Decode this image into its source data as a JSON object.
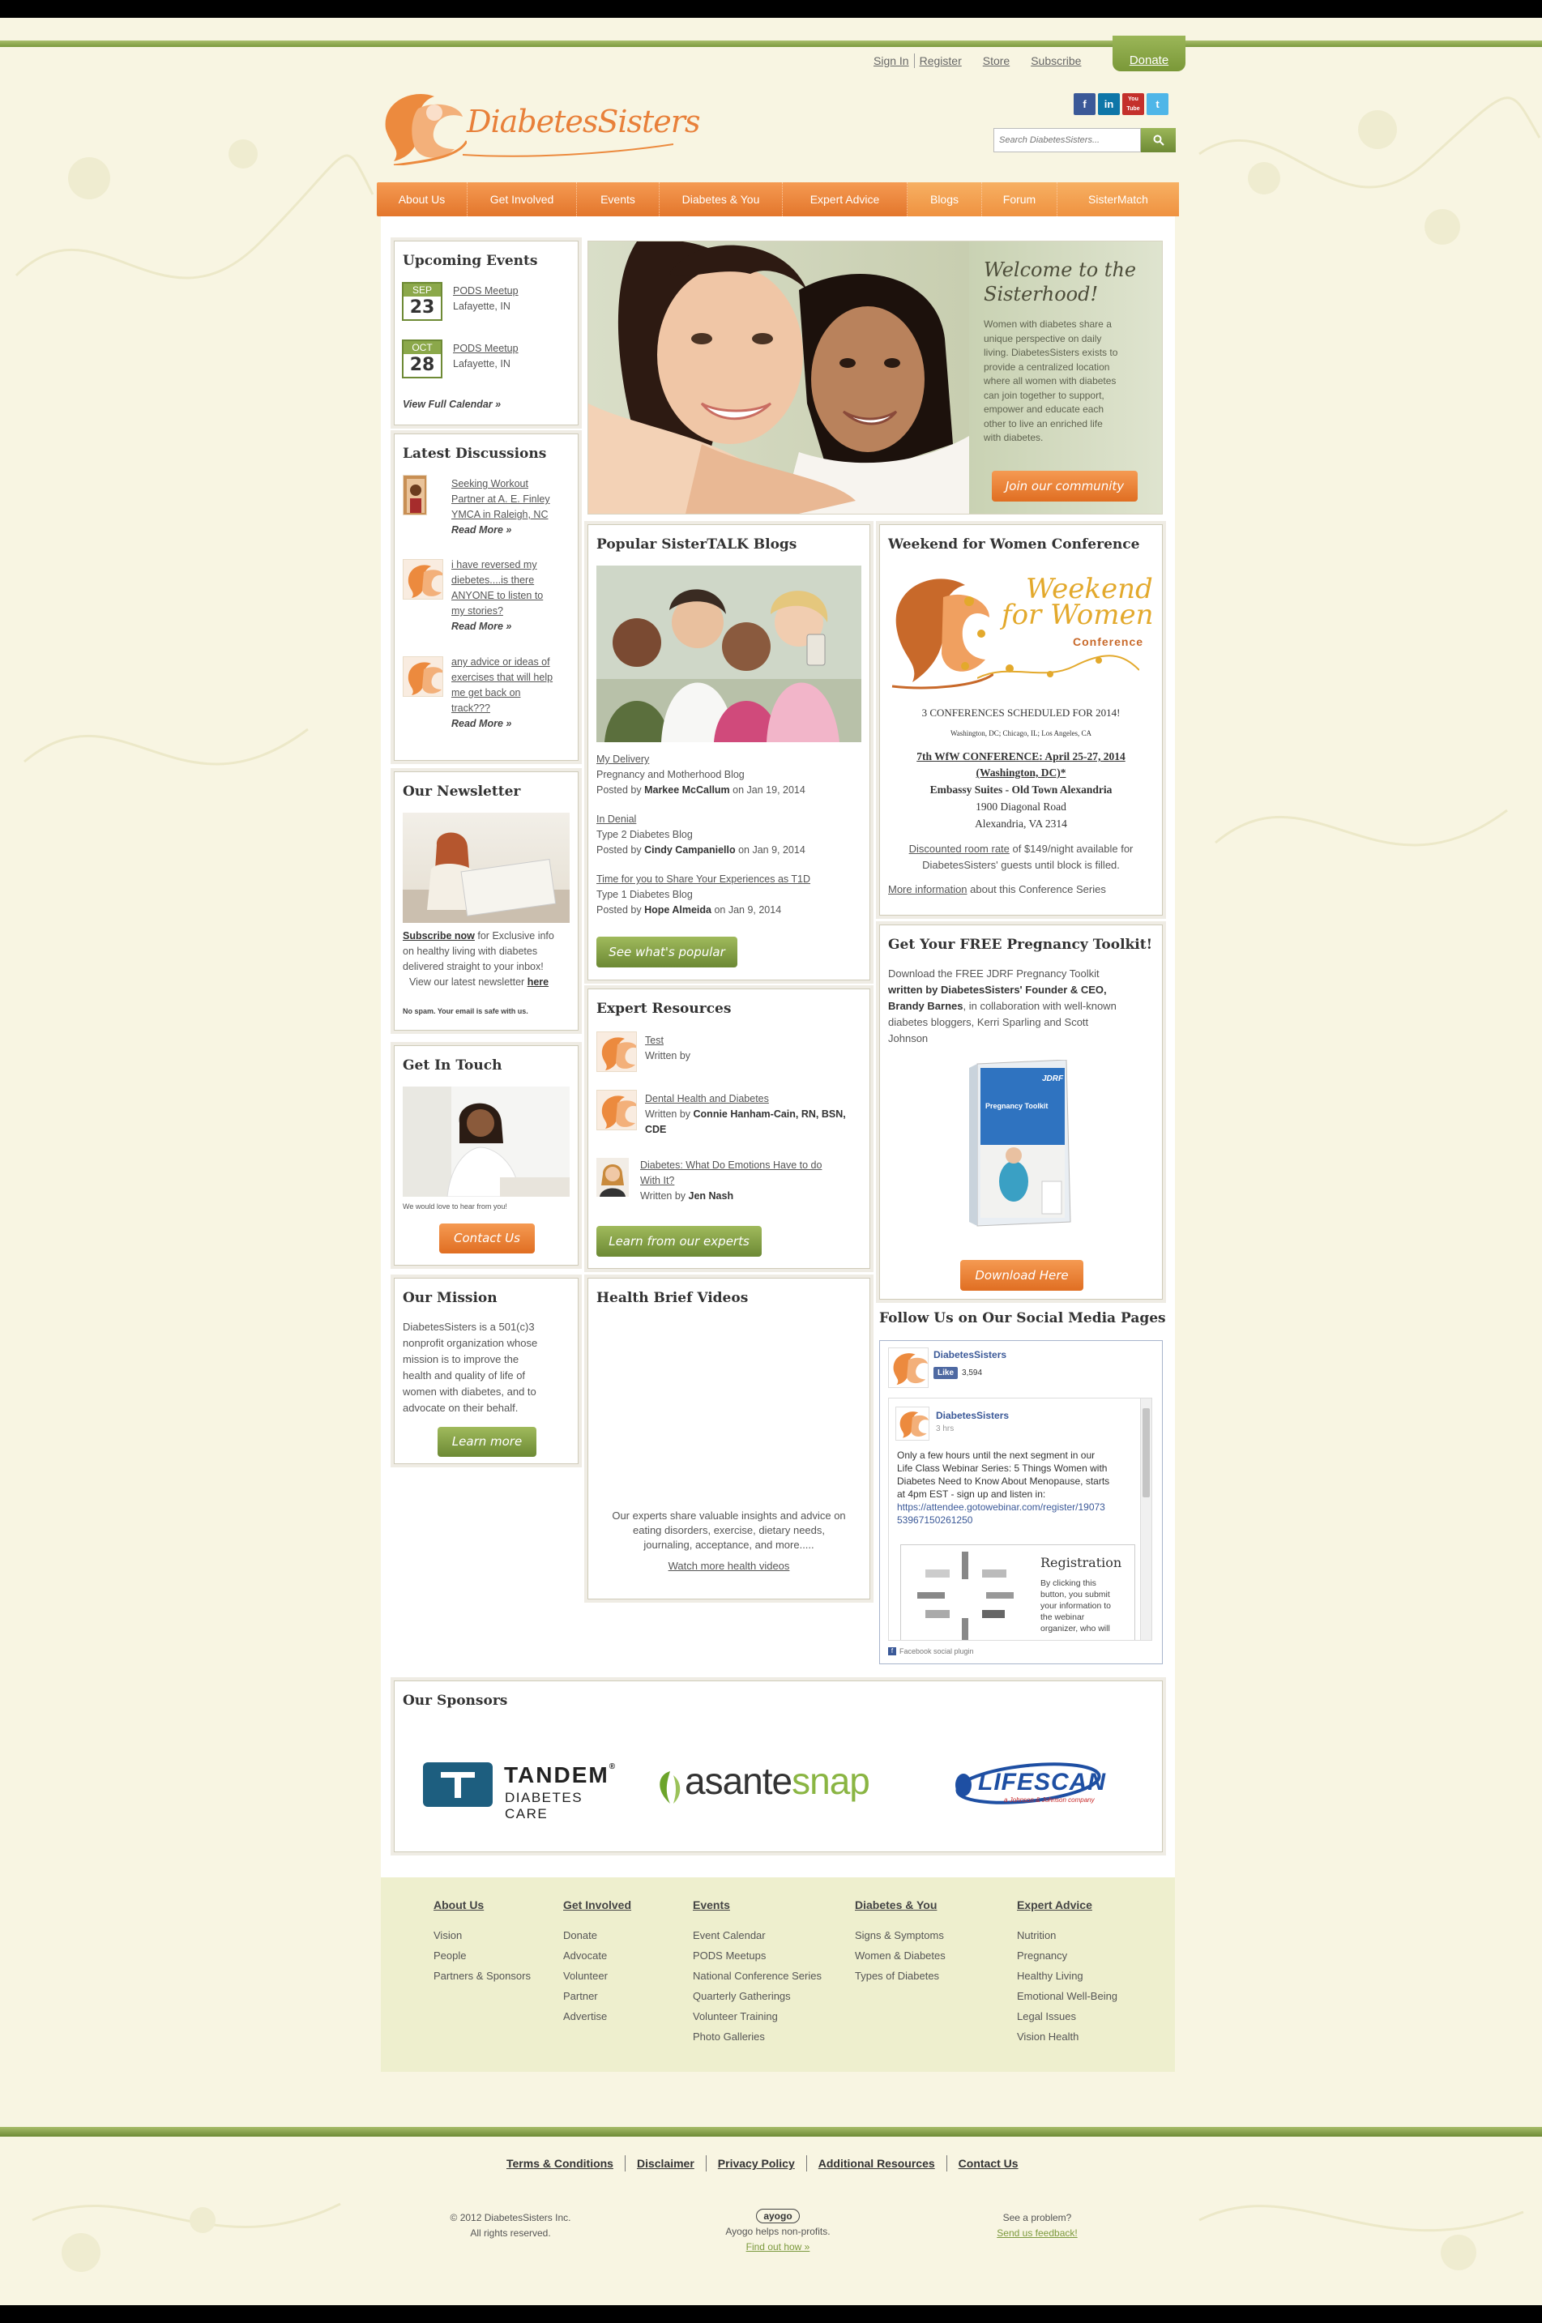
{
  "header": {
    "links": [
      "Sign In",
      "Register",
      "Store",
      "Subscribe"
    ],
    "donate": "Donate",
    "search_placeholder": "Search DiabetesSisters...",
    "logo_text": "DiabetesSisters",
    "social": [
      "f",
      "in",
      "You Tube",
      "t"
    ]
  },
  "nav": [
    "About Us",
    "Get Involved",
    "Events",
    "Diabetes & You",
    "Expert Advice",
    "Blogs",
    "Forum",
    "SisterMatch"
  ],
  "upcoming_events": {
    "title": "Upcoming Events",
    "events": [
      {
        "month": "SEP",
        "day": "23",
        "name": "PODS Meetup",
        "location": "Lafayette, IN"
      },
      {
        "month": "OCT",
        "day": "28",
        "name": "PODS Meetup",
        "location": "Lafayette, IN"
      }
    ],
    "calendar_link": "View Full Calendar »"
  },
  "discussions": {
    "title": "Latest Discussions",
    "items": [
      {
        "lines": [
          "Seeking Workout",
          "Partner at A. E. Finley",
          "YMCA in Raleigh, NC"
        ],
        "more": "Read More »"
      },
      {
        "lines": [
          "i have reversed my",
          "diebetes....is there",
          "ANYONE to listen to",
          "my stories?"
        ],
        "more": "Read More »"
      },
      {
        "lines": [
          "any advice or ideas of",
          "exercises that will help",
          "me get back on",
          "track???"
        ],
        "more": "Read More »"
      }
    ]
  },
  "newsletter": {
    "title": "Our Newsletter",
    "subscribe": "Subscribe now",
    "text_lines": [
      " for Exclusive info",
      "on healthy living with diabetes",
      "delivered straight to your inbox!"
    ],
    "view_prefix": "View our latest newsletter ",
    "view_link": "here",
    "spam": "No spam. Your email is safe with us."
  },
  "touch": {
    "title": "Get In Touch",
    "note": "We would love to hear from you!",
    "button": "Contact Us"
  },
  "mission": {
    "title": "Our Mission",
    "lines": [
      "DiabetesSisters is a 501(c)3",
      "nonprofit organization whose",
      "mission is to improve the",
      "health and quality of life of",
      "women with diabetes, and to",
      "advocate on their behalf."
    ],
    "button": "Learn more"
  },
  "hero": {
    "title_lines": [
      "Welcome to the",
      "Sisterhood!"
    ],
    "text_lines": [
      "Women with diabetes share a",
      "unique perspective on daily",
      "living.  DiabetesSisters exists to",
      "provide a centralized location",
      "where all women with diabetes",
      "can join together to support,",
      "empower and educate each",
      "other to live an enriched life",
      "with diabetes."
    ],
    "button": "Join our community"
  },
  "blogs": {
    "title": "Popular SisterTALK Blogs",
    "posts": [
      {
        "title": "My Delivery",
        "blog": "Pregnancy and Motherhood Blog",
        "posted": "Posted by ",
        "author": "Markee McCallum",
        "date": " on Jan 19, 2014"
      },
      {
        "title": "In Denial",
        "blog": "Type 2 Diabetes Blog",
        "posted": "Posted by ",
        "author": "Cindy Campaniello",
        "date": " on Jan 9, 2014"
      },
      {
        "title": "Time for you to Share Your Experiences as T1D",
        "blog": "Type 1 Diabetes Blog",
        "posted": "Posted by ",
        "author": "Hope Almeida",
        "date": " on Jan 9, 2014"
      }
    ],
    "button": "See what's popular"
  },
  "expert": {
    "title": "Expert Resources",
    "items": [
      {
        "title_lines": [
          "Test"
        ],
        "written": "Written by",
        "author_lines": []
      },
      {
        "title_lines": [
          "Dental Health and Diabetes"
        ],
        "written": "Written by ",
        "author_lines": [
          "Connie Hanham-Cain, RN, BSN,",
          "CDE"
        ]
      },
      {
        "title_lines": [
          "Diabetes: What Do Emotions Have to do",
          "With It?"
        ],
        "written": "Written by ",
        "author_lines": [
          "Jen Nash"
        ]
      }
    ],
    "button": "Learn from our experts"
  },
  "videos": {
    "title": "Health Brief Videos",
    "text_lines": [
      "Our experts share valuable insights and advice on",
      "eating disorders, exercise, dietary needs,",
      "journaling, acceptance, and more....."
    ],
    "link": "Watch more health videos"
  },
  "conference": {
    "title": "Weekend for Women Conference",
    "logo_lines": [
      "Weekend",
      "for Women",
      "Conference"
    ],
    "scheduled": "3 CONFERENCES SCHEDULED FOR 2014!",
    "cities": "Washington, DC;  Chicago, IL;  Los Angeles, CA",
    "seventh_lines": [
      "7th WfW CONFERENCE: April 25-27, 2014",
      "(Washington, DC)*"
    ],
    "venue": "Embassy Suites - Old Town Alexandria",
    "address_lines": [
      "1900 Diagonal Road",
      "Alexandria, VA 2314"
    ],
    "rate_link": "Discounted room rate",
    "rate_rest": " of $149/night available for",
    "rate_line2": "DiabetesSisters' guests until block is filled.",
    "more_link": "More information",
    "more_rest": " about this Conference Series"
  },
  "pregnancy": {
    "title": "Get Your FREE Pregnancy Toolkit!",
    "line1": "Download the FREE JDRF Pregnancy Toolkit",
    "line2": "written by DiabetesSisters' Founder & CEO,",
    "line3_bold": "Brandy Barnes",
    "line3_rest": ", in collaboration with well-known",
    "line4": "diabetes bloggers, Kerri Sparling and Scott",
    "line5": "Johnson",
    "book_brand": "JDRF",
    "book_title": "Pregnancy Toolkit",
    "button": "Download Here"
  },
  "follow": {
    "title": "Follow Us on Our Social Media Pages",
    "page_name": "DiabetesSisters",
    "like": "Like",
    "like_count": "3,594",
    "post_name": "DiabetesSisters",
    "post_time": "3 hrs",
    "post_lines": [
      "Only a few hours until the next segment in our",
      "Life Class Webinar Series: 5 Things Women with",
      "Diabetes Need to Know About Menopause, starts",
      "at 4pm EST - sign up and listen in:"
    ],
    "post_link_lines": [
      "https://attendee.gotowebinar.com/register/19073",
      "53967150261250"
    ],
    "reg_title": "Registration",
    "reg_lines": [
      "By clicking this",
      "button, you submit",
      "your information to",
      "the webinar",
      "organizer, who will"
    ],
    "plugin": "Facebook social plugin"
  },
  "sponsors": {
    "title": "Our Sponsors",
    "tandem": "TANDEM",
    "tandem_reg": "®",
    "tandem_sub": "DIABETES CARE",
    "asante_a": "asante",
    "asante_b": "snap",
    "lifescan": "LIFESCAN",
    "lifescan_sub": "a Johnson & Johnson company"
  },
  "footer_nav": [
    {
      "title": "About Us",
      "items": [
        "Vision",
        "People",
        "Partners & Sponsors"
      ]
    },
    {
      "title": "Get Involved",
      "items": [
        "Donate",
        "Advocate",
        "Volunteer",
        "Partner",
        "Advertise"
      ]
    },
    {
      "title": "Events",
      "items": [
        "Event Calendar",
        "PODS Meetups",
        "National Conference Series",
        "Quarterly Gatherings",
        "Volunteer Training",
        "Photo Galleries"
      ]
    },
    {
      "title": "Diabetes & You",
      "items": [
        "Signs & Symptoms",
        "Women & Diabetes",
        "Types of Diabetes"
      ]
    },
    {
      "title": "Expert Advice",
      "items": [
        "Nutrition",
        "Pregnancy",
        "Healthy Living",
        "Emotional Well-Being",
        "Legal Issues",
        "Vision Health"
      ]
    }
  ],
  "bottom_links": [
    "Terms & Conditions",
    "Disclaimer",
    "Privacy Policy",
    "Additional Resources",
    "Contact Us"
  ],
  "copyright_lines": [
    "© 2012 DiabetesSisters Inc.",
    "All rights reserved."
  ],
  "ayogo": {
    "logo": "ayogo",
    "text": "Ayogo helps non-profits.",
    "link": "Find out how »"
  },
  "problem": {
    "text": "See a problem?",
    "link": "Send us feedback!"
  },
  "colors": {
    "orange": "#ef8336",
    "green": "#7c9a3e",
    "cream": "#f8f5e2"
  }
}
